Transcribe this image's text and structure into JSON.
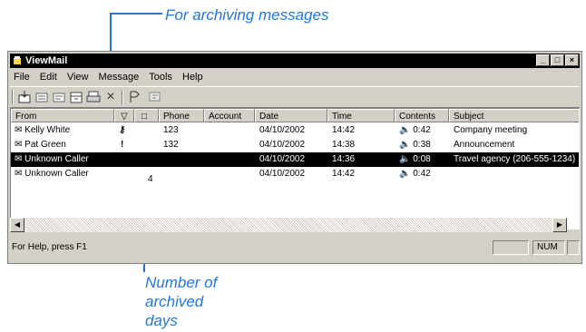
{
  "callouts": {
    "top": "For archiving messages",
    "bottom_line1": "Number of",
    "bottom_line2": "archived",
    "bottom_line3": "days"
  },
  "window": {
    "title": "ViewMail",
    "min": "_",
    "max": "□",
    "close": "×"
  },
  "menu": [
    "File",
    "Edit",
    "View",
    "Message",
    "Tools",
    "Help"
  ],
  "toolbar": {
    "icons": [
      "new-message-icon",
      "reply-icon",
      "forward-icon",
      "archive-icon",
      "print-icon",
      "delete-icon",
      "play-icon",
      "stop-icon"
    ]
  },
  "columns": [
    "From",
    "▽",
    "□",
    "Phone",
    "Account",
    "Date",
    "Time",
    "Contents",
    "Subject"
  ],
  "rows": [
    {
      "from": "Kelly White",
      "flag": "🔑",
      "folder": "",
      "phone": "123",
      "account": "",
      "date": "04/10/2002",
      "time": "14:42",
      "contents": "0:42",
      "subject": "Company meeting",
      "selected": false
    },
    {
      "from": "Pat Green",
      "flag": "!",
      "folder": "",
      "phone": "132",
      "account": "",
      "date": "04/10/2002",
      "time": "14:38",
      "contents": "0:38",
      "subject": "Announcement",
      "selected": false
    },
    {
      "from": "Unknown Caller",
      "flag": "",
      "folder": "",
      "phone": "",
      "account": "",
      "date": "04/10/2002",
      "time": "14:36",
      "contents": "0:08",
      "subject": "Travel agency (206-555-1234)",
      "selected": true
    },
    {
      "from": "Unknown Caller",
      "flag": "",
      "folder": "4",
      "phone": "",
      "account": "",
      "date": "04/10/2002",
      "time": "14:42",
      "contents": "0:42",
      "subject": "",
      "selected": false
    }
  ],
  "status": {
    "help": "For Help, press F1",
    "num": "NUM"
  },
  "colors": {
    "accent": "#1f77d8",
    "selection": "#000000",
    "face": "#d4d0c8"
  }
}
